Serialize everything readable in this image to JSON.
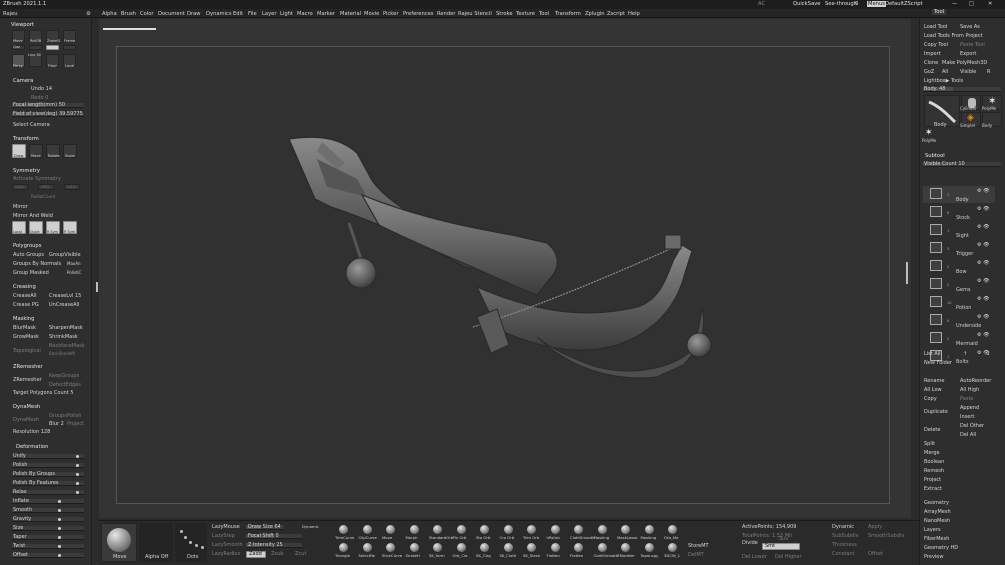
{
  "titlebar": {
    "app_title": "ZBrush 2021.1.1",
    "doc_name": "Rajeu",
    "ac": "AC",
    "quicksave": "QuickSave",
    "seethrough": "See-through",
    "seethrough_val": "0",
    "menus": "Menus",
    "script": "DefaultZScript"
  },
  "menubar": {
    "items": [
      "Alpha",
      "Brush",
      "Color",
      "Document",
      "Draw",
      "Dynamics",
      "Edit",
      "File",
      "Layer",
      "Light",
      "Macro",
      "Marker",
      "Material",
      "Movie",
      "Picker",
      "Preferences",
      "Render",
      "Rajeu Stencil",
      "Stroke",
      "Texture",
      "Tool",
      "Transform",
      "Zplugin",
      "Zscript",
      "Help"
    ]
  },
  "left": {
    "viewport_title": "Viewport",
    "vp_buttons": [
      "Move",
      "RotGB",
      "ZoomD",
      "Frame"
    ],
    "vp_small": [
      "Qxz",
      "",
      "",
      "Line Fill",
      "Persp",
      "Floor",
      "Local",
      "Gxy"
    ],
    "camera_title": "Camera",
    "undo": "Undo 14",
    "redo": "Redo 0",
    "focal": "Focal length(mm) 50",
    "fov": "Field of view(deg) 39.59775",
    "select_camera": "Select Camera",
    "transform_title": "Transform",
    "tr_buttons": [
      "Draw",
      "Move",
      "Rotate",
      "Scale"
    ],
    "symmetry_title": "Symmetry",
    "activate_symmetry": "Activate Symmetry",
    "xyz": [
      ">X<",
      ">Y<",
      ">Z<"
    ],
    "radialcount": "RadialCount",
    "mirror": "Mirror",
    "mirror_weld": "Mirror And Weld",
    "sym_buttons": [
      "Local",
      "Quick",
      "R Sym",
      "P. Sym"
    ],
    "polygroups_title": "Polygroups",
    "auto_groups": "Auto Groups",
    "group_visible": "GroupVisible",
    "groups_by_normals": "Groups By Normals",
    "maxan": "MaxAn",
    "group_masked": "Group Masked",
    "polishc": "PolishC",
    "creasing_title": "Creasing",
    "crease_all": "CreaseAll",
    "crease_lvl": "CreaseLvl 15",
    "crease_pg": "Crease PG",
    "uncrease_all": "UnCreaseAll",
    "masking_title": "Masking",
    "blur_mask": "BlurMask",
    "sharpen_mask": "SharpenMask",
    "grow_mask": "GrowMask",
    "shrink_mask": "ShrinkMask",
    "backface_mask": "BackfaceMask",
    "topological": "Topological",
    "backshade": "BackShadeM",
    "zremesher_title": "ZRemesher",
    "zremesher": "ZRemesher",
    "keep_groups": "KeepGroups",
    "detect_edges": "DetectEdges",
    "target_poly": "Target Polygons Count 5",
    "dynamesh_title": "DynaMesh",
    "dynamesh": "DynaMesh",
    "groups": "Groups",
    "polish": "Polish",
    "blur": "Blur 2",
    "project": "Project",
    "resolution": "Resolution 128",
    "deformation_title": "Deformation",
    "deform_items": [
      "Unify",
      "Polish",
      "Polish By Groups",
      "Polish By Features",
      "Relax",
      "Inflate",
      "Smooth",
      "Gravity",
      "Size",
      "Taper",
      "Twist",
      "Offset"
    ]
  },
  "bottom": {
    "brush_main": "Move",
    "alpha": "Alpha Off",
    "stroke": "Dots",
    "lazymouse": "LazyMouse",
    "lazystep": "LazyStep",
    "lazysmooth": "LazySmooth",
    "lazyradius": "LazyRadius",
    "drawsize": "Draw Size 64",
    "dynamic": "Dynamic",
    "focalshift": "Focal Shift 0",
    "zintensity": "Z Intensity 25",
    "zadd": "Zadd",
    "zsub": "Zsub",
    "zcut": "Zcut",
    "brushes_row1": [
      "TrimCurve",
      "ClipCurve",
      "Move",
      "Morph",
      "StandardOrb",
      "Pin Orb",
      "Sta Orb",
      "Cro Orb",
      "Trim Orb",
      "hPolish",
      "ClothSmooth",
      "Masking",
      "MaskLasso",
      "Masking",
      "Orb_Me"
    ],
    "brushes_row2": [
      "Triangle",
      "SelectRe",
      "SliceCurve",
      "SnakeH",
      "SK_form",
      "Orb_Cla",
      "SK_Clay",
      "SK_Cloth",
      "SK_Slash",
      "Flatten",
      "Flatten",
      "ClothSmooth",
      "ZModeler",
      "TopoLogy",
      "3DCW_1"
    ],
    "storemt": "StoreMT",
    "delmt": "DelMT",
    "active_points": "ActivePoints: 154,909",
    "total_points": "TotalPoints: 1.53 Mil",
    "divide": "Divide",
    "smt": "Smt",
    "suv": "Suv",
    "dellower": "Del Lower",
    "delhigher": "Del Higher",
    "dynamic2": "Dynamic",
    "apply": "Apply",
    "thickness": "Thickness",
    "offset": "Offset",
    "subdiv": "SubSubdiv",
    "constant": "Constant",
    "subdivs": "SmoothSubdiv"
  },
  "right": {
    "tool_title": "Tool",
    "load_tool": "Load Tool",
    "save_as": "Save As",
    "load_tools_project": "Load Tools From Project",
    "copy_tool": "Copy Tool",
    "paste_tool": "Paste Tool",
    "import": "Import",
    "export": "Export",
    "clone": "Clone",
    "make_polymesh": "Make PolyMesh3D",
    "goz": "GoZ",
    "all": "All",
    "visible": "Visible",
    "r": "R",
    "lightbox_tools": "Lightbox▶ Tools",
    "body_slider": "Body. 48",
    "tool_thumbs": [
      "Body",
      "Cylinder",
      "PolyMe",
      "SimpleI",
      "Body",
      "PolyMe"
    ],
    "subtool_title": "Subtool",
    "visible_count": "Visible Count 10",
    "subtools": [
      {
        "idx": "1",
        "name": "Body"
      },
      {
        "idx": "6",
        "name": "Stock"
      },
      {
        "idx": "1",
        "name": "Sight"
      },
      {
        "idx": "3",
        "name": "Trigger"
      },
      {
        "idx": "2",
        "name": "Bow"
      },
      {
        "idx": "2",
        "name": "Gems"
      },
      {
        "idx": "10",
        "name": "Potion"
      },
      {
        "idx": "4",
        "name": "Underside"
      },
      {
        "idx": "2",
        "name": "Mermaid"
      },
      {
        "idx": "1",
        "name": "Bolts"
      }
    ],
    "list_all": "List All",
    "new_folder": "New Folder",
    "rename": "Rename",
    "auto_reorder": "AutoReorder",
    "all_low": "All Low",
    "all_high": "All High",
    "copy": "Copy",
    "paste": "Paste",
    "duplicate": "Duplicate",
    "append": "Append",
    "insert": "Insert",
    "delete": "Delete",
    "del_other": "Del Other",
    "del_all": "Del All",
    "split": "Split",
    "merge": "Merge",
    "boolean": "Boolean",
    "remesh": "Remesh",
    "project": "Project",
    "extract": "Extract",
    "geometry": "Geometry",
    "arraymesh": "ArrayMesh",
    "nanomesh": "NanoMesh",
    "layers": "Layers",
    "fibermesh": "FiberMesh",
    "geometry_hd": "Geometry HD",
    "preview": "Preview"
  },
  "colors": {
    "bg": "#2b2b2b",
    "panel": "#2e2e2e",
    "canvas": "#313131",
    "model": "#6a6a6a",
    "accent": "#e0e0e0"
  }
}
